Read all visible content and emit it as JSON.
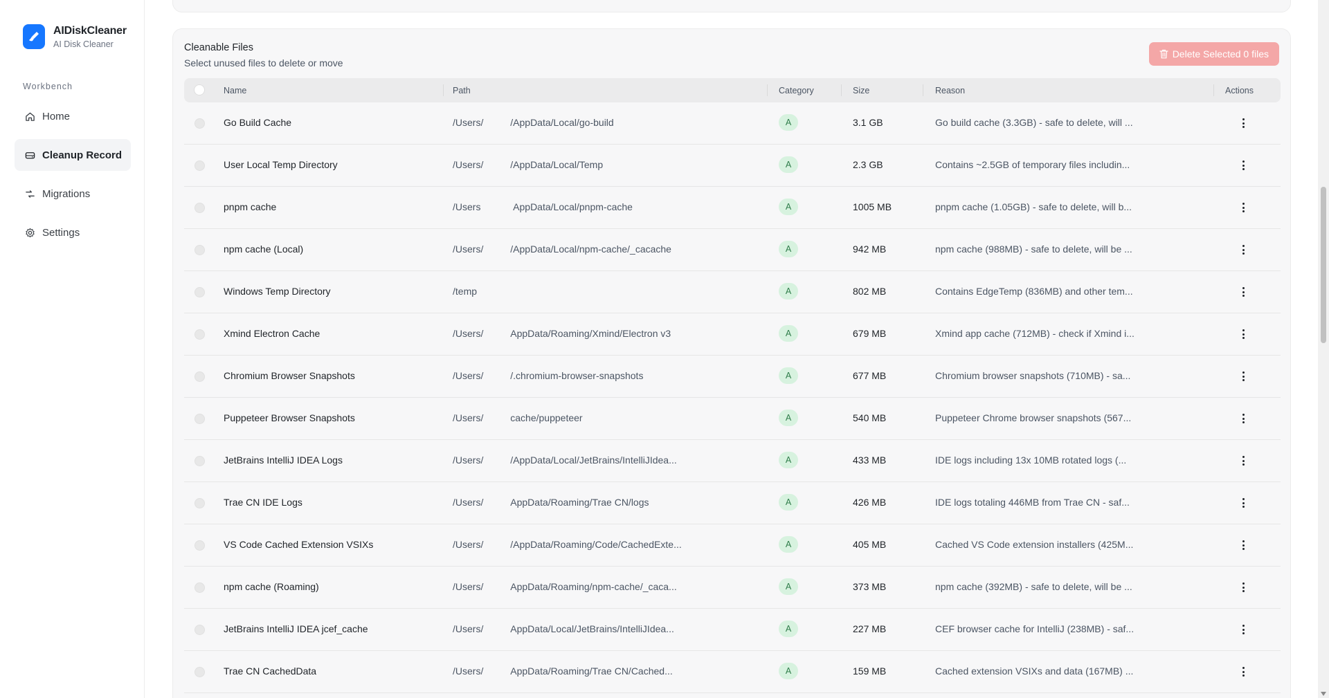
{
  "brand": {
    "title": "AIDiskCleaner",
    "subtitle": "AI Disk Cleaner",
    "icon": "broom-icon",
    "color": "#1677ff"
  },
  "sidebar": {
    "section_label": "Workbench",
    "items": [
      {
        "label": "Home",
        "icon": "home-icon",
        "active": false
      },
      {
        "label": "Cleanup Record",
        "icon": "drive-icon",
        "active": true
      },
      {
        "label": "Migrations",
        "icon": "migrate-icon",
        "active": false
      },
      {
        "label": "Settings",
        "icon": "gear-icon",
        "active": false
      }
    ]
  },
  "card": {
    "title": "Cleanable Files",
    "subtitle": "Select unused files to delete or move",
    "delete_button": "Delete Selected 0 files",
    "delete_button_color": "#f4a7a7"
  },
  "table": {
    "columns": [
      "Name",
      "Path",
      "Category",
      "Size",
      "Reason",
      "Actions"
    ],
    "rows": [
      {
        "name": "Go Build Cache",
        "path": "/Users/     /AppData/Local/go-build",
        "category": "A",
        "size": "3.1 GB",
        "reason": "Go build cache (3.3GB) - safe to delete, will ..."
      },
      {
        "name": "User Local Temp Directory",
        "path": "/Users/     /AppData/Local/Temp",
        "category": "A",
        "size": "2.3 GB",
        "reason": "Contains ~2.5GB of temporary files includin..."
      },
      {
        "name": "pnpm cache",
        "path": "/Users      AppData/Local/pnpm-cache",
        "category": "A",
        "size": "1005 MB",
        "reason": "pnpm cache (1.05GB) - safe to delete, will b..."
      },
      {
        "name": "npm cache (Local)",
        "path": "/Users/     /AppData/Local/npm-cache/_cacache",
        "category": "A",
        "size": "942 MB",
        "reason": "npm cache (988MB) - safe to delete, will be ..."
      },
      {
        "name": "Windows Temp Directory",
        "path": "/temp",
        "category": "A",
        "size": "802 MB",
        "reason": "Contains EdgeTemp (836MB) and other tem..."
      },
      {
        "name": "Xmind Electron Cache",
        "path": "/Users/     AppData/Roaming/Xmind/Electron v3",
        "category": "A",
        "size": "679 MB",
        "reason": "Xmind app cache (712MB) - check if Xmind i..."
      },
      {
        "name": "Chromium Browser Snapshots",
        "path": "/Users/     /.chromium-browser-snapshots",
        "category": "A",
        "size": "677 MB",
        "reason": "Chromium browser snapshots (710MB) - sa..."
      },
      {
        "name": "Puppeteer Browser Snapshots",
        "path": "/Users/     cache/puppeteer",
        "category": "A",
        "size": "540 MB",
        "reason": "Puppeteer Chrome browser snapshots (567..."
      },
      {
        "name": "JetBrains IntelliJ IDEA Logs",
        "path": "/Users/     /AppData/Local/JetBrains/IntelliJIdea...",
        "category": "A",
        "size": "433 MB",
        "reason": "IDE logs including 13x 10MB rotated logs (..."
      },
      {
        "name": "Trae CN IDE Logs",
        "path": "/Users/     AppData/Roaming/Trae CN/logs",
        "category": "A",
        "size": "426 MB",
        "reason": "IDE logs totaling 446MB from Trae CN - saf..."
      },
      {
        "name": "VS Code Cached Extension VSIXs",
        "path": "/Users/     /AppData/Roaming/Code/CachedExte...",
        "category": "A",
        "size": "405 MB",
        "reason": "Cached VS Code extension installers (425M..."
      },
      {
        "name": "npm cache (Roaming)",
        "path": "/Users/     AppData/Roaming/npm-cache/_caca...",
        "category": "A",
        "size": "373 MB",
        "reason": "npm cache (392MB) - safe to delete, will be ..."
      },
      {
        "name": "JetBrains IntelliJ IDEA jcef_cache",
        "path": "/Users/     AppData/Local/JetBrains/IntelliJIdea...",
        "category": "A",
        "size": "227 MB",
        "reason": "CEF browser cache for IntelliJ (238MB) - saf..."
      },
      {
        "name": "Trae CN CachedData",
        "path": "/Users/     AppData/Roaming/Trae CN/Cached...",
        "category": "A",
        "size": "159 MB",
        "reason": "Cached extension VSIXs and data (167MB) ..."
      }
    ]
  }
}
